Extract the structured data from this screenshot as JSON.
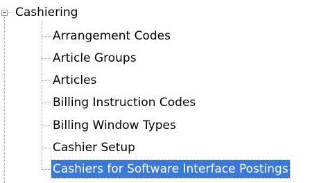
{
  "tree": {
    "root": {
      "label": "Cashiering",
      "expander_icon": "minus-box-icon",
      "expanded": true
    },
    "children": [
      {
        "label": "Arrangement Codes",
        "selected": false
      },
      {
        "label": "Article Groups",
        "selected": false
      },
      {
        "label": "Articles",
        "selected": false
      },
      {
        "label": "Billing Instruction Codes",
        "selected": false
      },
      {
        "label": "Billing Window Types",
        "selected": false
      },
      {
        "label": "Cashier Setup",
        "selected": false
      },
      {
        "label": "Cashiers for Software Interface Postings",
        "selected": true
      }
    ],
    "colors": {
      "selection_bg": "#3a79d6",
      "selection_text": "#ffffff",
      "connector": "#a0a0a0"
    }
  }
}
